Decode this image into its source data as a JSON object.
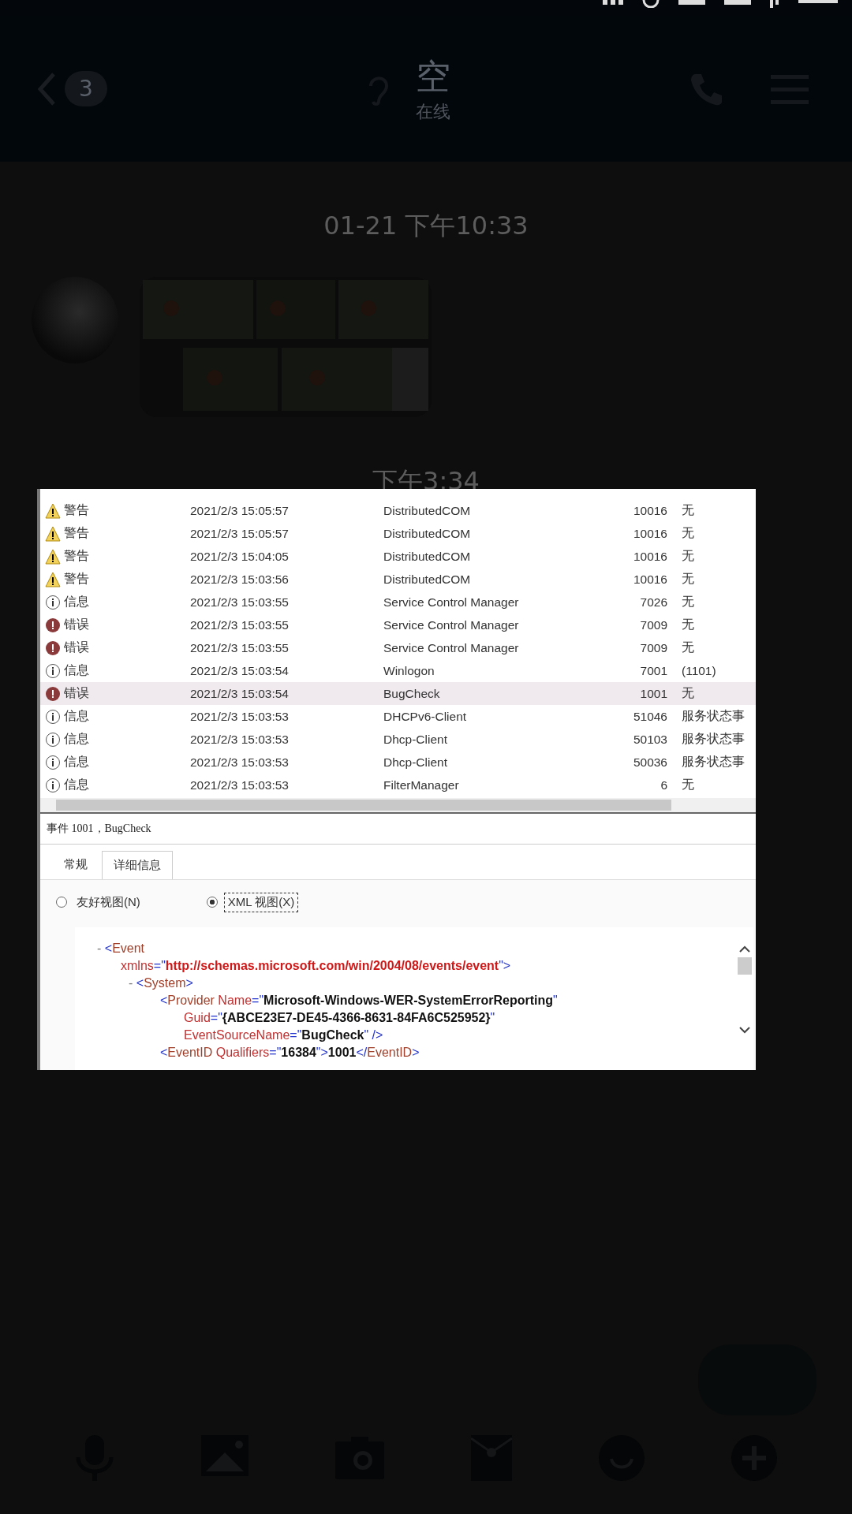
{
  "header": {
    "unread_badge": "3",
    "contact_name": "空",
    "presence": "在线"
  },
  "chat": {
    "timestamps": [
      "01-21 下午10:33",
      "下午3:34"
    ],
    "messages": [
      {
        "kind": "picture"
      }
    ]
  },
  "image_viewer": {
    "events": [
      {
        "kind": "warning",
        "level_text": "警告",
        "date": "2021/2/3 15:05:57",
        "source": "DistributedCOM",
        "event_id": "10016",
        "category": "无",
        "selected": false
      },
      {
        "kind": "warning",
        "level_text": "警告",
        "date": "2021/2/3 15:05:57",
        "source": "DistributedCOM",
        "event_id": "10016",
        "category": "无",
        "selected": false
      },
      {
        "kind": "warning",
        "level_text": "警告",
        "date": "2021/2/3 15:04:05",
        "source": "DistributedCOM",
        "event_id": "10016",
        "category": "无",
        "selected": false
      },
      {
        "kind": "warning",
        "level_text": "警告",
        "date": "2021/2/3 15:03:56",
        "source": "DistributedCOM",
        "event_id": "10016",
        "category": "无",
        "selected": false
      },
      {
        "kind": "info",
        "level_text": "信息",
        "date": "2021/2/3 15:03:55",
        "source": "Service Control Manager",
        "event_id": "7026",
        "category": "无",
        "selected": false
      },
      {
        "kind": "error",
        "level_text": "错误",
        "date": "2021/2/3 15:03:55",
        "source": "Service Control Manager",
        "event_id": "7009",
        "category": "无",
        "selected": false
      },
      {
        "kind": "error",
        "level_text": "错误",
        "date": "2021/2/3 15:03:55",
        "source": "Service Control Manager",
        "event_id": "7009",
        "category": "无",
        "selected": false
      },
      {
        "kind": "info",
        "level_text": "信息",
        "date": "2021/2/3 15:03:54",
        "source": "Winlogon",
        "event_id": "7001",
        "category": "(1101)",
        "selected": false
      },
      {
        "kind": "error",
        "level_text": "错误",
        "date": "2021/2/3 15:03:54",
        "source": "BugCheck",
        "event_id": "1001",
        "category": "无",
        "selected": true
      },
      {
        "kind": "info",
        "level_text": "信息",
        "date": "2021/2/3 15:03:53",
        "source": "DHCPv6-Client",
        "event_id": "51046",
        "category": "服务状态事",
        "selected": false
      },
      {
        "kind": "info",
        "level_text": "信息",
        "date": "2021/2/3 15:03:53",
        "source": "Dhcp-Client",
        "event_id": "50103",
        "category": "服务状态事",
        "selected": false
      },
      {
        "kind": "info",
        "level_text": "信息",
        "date": "2021/2/3 15:03:53",
        "source": "Dhcp-Client",
        "event_id": "50036",
        "category": "服务状态事",
        "selected": false
      },
      {
        "kind": "info",
        "level_text": "信息",
        "date": "2021/2/3 15:03:53",
        "source": "FilterManager",
        "event_id": "6",
        "category": "无",
        "selected": false
      }
    ],
    "detail_title": "事件 1001，BugCheck",
    "tabs": [
      {
        "label": "常规",
        "selected": false
      },
      {
        "label": "详细信息",
        "selected": true
      }
    ],
    "view_options": [
      {
        "label": "友好视图(N)",
        "selected": false
      },
      {
        "label": "XML 视图(X)",
        "selected": true
      }
    ],
    "xml": [
      {
        "toggle": "-",
        "lines": [
          [
            {
              "t": "<",
              "kind": "mark"
            },
            {
              "t": "Event",
              "kind": "tag"
            }
          ],
          [
            {
              "t": "xmlns",
              "kind": "attr"
            },
            {
              "t": "=\"",
              "kind": "mark"
            },
            {
              "t": "http://schemas.microsoft.com/win/2004/08/events/event",
              "kind": "url"
            },
            {
              "t": "\">",
              "kind": "mark"
            }
          ]
        ],
        "children": [
          {
            "toggle": "-",
            "lines": [
              [
                {
                  "t": "<",
                  "kind": "mark"
                },
                {
                  "t": "System",
                  "kind": "tag"
                },
                {
                  "t": ">",
                  "kind": "mark"
                }
              ]
            ],
            "children": [
              {
                "lines": [
                  [
                    {
                      "t": "<",
                      "kind": "mark"
                    },
                    {
                      "t": "Provider",
                      "kind": "tag"
                    },
                    {
                      "t": " Name",
                      "kind": "attr"
                    },
                    {
                      "t": "=\"",
                      "kind": "mark"
                    },
                    {
                      "t": "Microsoft-Windows-WER-SystemErrorReporting",
                      "kind": "value"
                    },
                    {
                      "t": "\"",
                      "kind": "mark"
                    }
                  ],
                  [
                    {
                      "t": "Guid",
                      "kind": "attr"
                    },
                    {
                      "t": "=\"",
                      "kind": "mark"
                    },
                    {
                      "t": "{ABCE23E7-DE45-4366-8631-84FA6C525952}",
                      "kind": "value"
                    },
                    {
                      "t": "\"",
                      "kind": "mark"
                    }
                  ],
                  [
                    {
                      "t": "EventSourceName",
                      "kind": "attr"
                    },
                    {
                      "t": "=\"",
                      "kind": "mark"
                    },
                    {
                      "t": "BugCheck",
                      "kind": "value"
                    },
                    {
                      "t": "\" />",
                      "kind": "mark"
                    }
                  ]
                ]
              },
              {
                "lines": [
                  [
                    {
                      "t": "<",
                      "kind": "mark"
                    },
                    {
                      "t": "EventID",
                      "kind": "tag"
                    },
                    {
                      "t": " Qualifiers",
                      "kind": "attr"
                    },
                    {
                      "t": "=\"",
                      "kind": "mark"
                    },
                    {
                      "t": "16384",
                      "kind": "value"
                    },
                    {
                      "t": "\">",
                      "kind": "mark"
                    },
                    {
                      "t": "1001",
                      "kind": "value"
                    },
                    {
                      "t": "</",
                      "kind": "mark"
                    },
                    {
                      "t": "EventID",
                      "kind": "tag"
                    },
                    {
                      "t": ">",
                      "kind": "mark"
                    }
                  ]
                ]
              }
            ]
          }
        ]
      }
    ]
  }
}
